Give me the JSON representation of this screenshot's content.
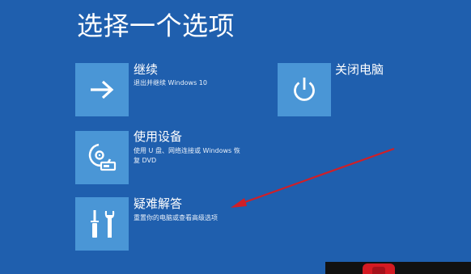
{
  "page": {
    "title": "选择一个选项"
  },
  "options": {
    "continue": {
      "title": "继续",
      "description": "退出并继续 Windows 10",
      "icon": "arrow-right-icon"
    },
    "use_device": {
      "title": "使用设备",
      "description_line1": "使用 U 盘、网络连接或 Windows 恢",
      "description_line2": "复 DVD",
      "icon": "disc-drive-icon"
    },
    "troubleshoot": {
      "title": "疑难解答",
      "description": "重置你的电脑或查看高级选项",
      "icon": "tools-icon"
    },
    "shutdown": {
      "title": "关闭电脑",
      "icon": "power-icon"
    }
  },
  "colors": {
    "background": "#1f5fae",
    "tile": "#4a96d6",
    "annotation_arrow": "#d01f27"
  }
}
